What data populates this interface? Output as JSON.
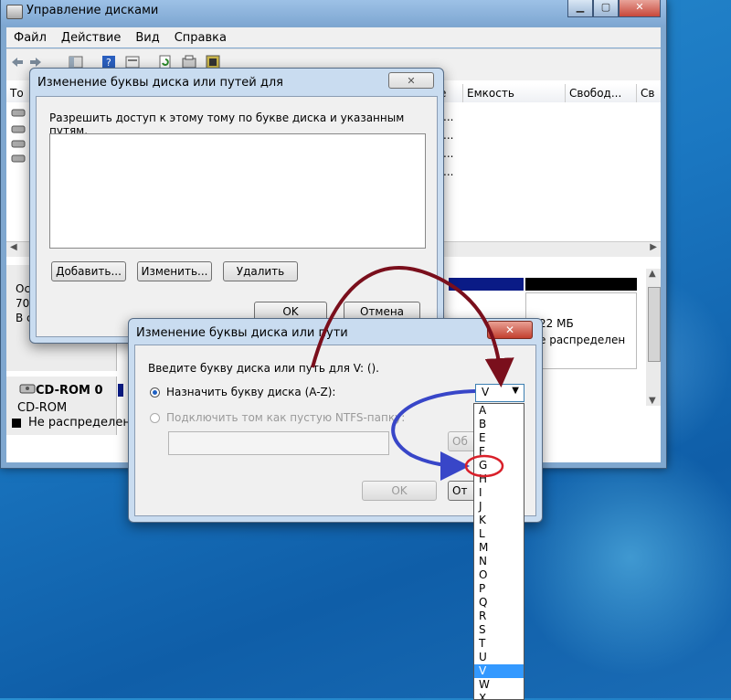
{
  "main_window": {
    "title": "Управление дисками",
    "controls": {
      "minimize": "▁",
      "maximize": "▢",
      "close": "✕"
    },
    "menu": [
      "Файл",
      "Действие",
      "Вид",
      "Справка"
    ],
    "columns": [
      "То",
      "е",
      "Емкость",
      "Свобод...",
      "Св"
    ],
    "volume_rows_trunc": [
      "...",
      "...",
      "...",
      "..."
    ],
    "disk_panel": {
      "left_lines": [
        "Ос",
        "70,",
        "В с"
      ],
      "partition_size": "22 МБ",
      "partition_status": "е распределен",
      "cdrom_name": "CD-ROM 0",
      "cdrom_type": "CD-ROM",
      "legend_unallocated": "Не распределен"
    }
  },
  "back_dialog": {
    "title": "Изменение буквы диска или путей для",
    "description": "Разрешить доступ к этому тому по букве диска и указанным путям.",
    "buttons": {
      "add": "Добавить...",
      "change": "Изменить...",
      "remove": "Удалить",
      "ok": "OK",
      "cancel": "Отмена"
    }
  },
  "front_dialog": {
    "title": "Изменение буквы диска или пути",
    "prompt": "Введите букву диска или путь для V: ().",
    "option_assign": "Назначить букву диска (A-Z):",
    "option_mount": "Подключить том как пустую NTFS-папку:",
    "browse_trunc": "Об",
    "ok": "OK",
    "cancel_trunc": "От",
    "selected_letter": "V",
    "letters": [
      "A",
      "B",
      "E",
      "F",
      "G",
      "H",
      "I",
      "J",
      "K",
      "L",
      "M",
      "N",
      "O",
      "P",
      "Q",
      "R",
      "S",
      "T",
      "U",
      "V",
      "W",
      "X"
    ]
  },
  "colors": {
    "arrow_red": "#7a0f1c",
    "arrow_blue": "#3846c8",
    "highlight_circle": "#d9202a",
    "list_selection": "#3399ff"
  }
}
